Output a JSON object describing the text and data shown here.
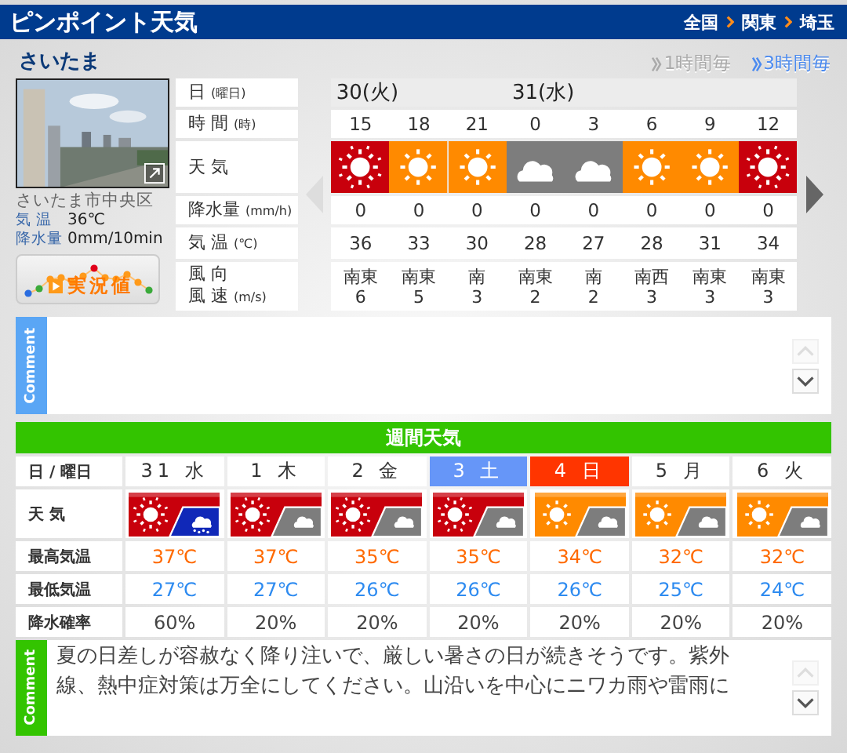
{
  "header": {
    "title": "ピンポイント天気",
    "breadcrumb": [
      "全国",
      "関東",
      "埼玉"
    ]
  },
  "location": "さいたま",
  "intervals": [
    {
      "label": "1時間毎",
      "selected": false
    },
    {
      "label": "3時間毎",
      "selected": true
    }
  ],
  "observation": {
    "place": "さいたま市中央区",
    "readings": [
      {
        "label": "気 温",
        "value": "36℃"
      },
      {
        "label": "降水量",
        "value": "0mm/10min"
      }
    ],
    "button": "実況値"
  },
  "hourly": {
    "prev_disabled": true,
    "next_disabled": false,
    "row_labels": [
      {
        "text": "日",
        "unit": "(曜日)"
      },
      {
        "text": "時 間",
        "unit": "(時)"
      },
      {
        "text": "天 気"
      },
      {
        "text": "降水量",
        "unit": "(mm/h)"
      },
      {
        "text": "気 温",
        "unit": "(℃)"
      },
      {
        "text": "風 向",
        "text2": "風 速",
        "unit": "(m/s)"
      }
    ],
    "dates": [
      {
        "label": "30(火)",
        "hours": [
          {
            "time": "15",
            "kind": "hot",
            "precip": "0",
            "temp": "36",
            "wind_dir": "南東",
            "wind_speed": "6"
          },
          {
            "time": "18",
            "kind": "sunny",
            "precip": "0",
            "temp": "33",
            "wind_dir": "南東",
            "wind_speed": "5"
          },
          {
            "time": "21",
            "kind": "sunny",
            "precip": "0",
            "temp": "30",
            "wind_dir": "南",
            "wind_speed": "3"
          }
        ]
      },
      {
        "label": "31(水)",
        "hours": [
          {
            "time": "0",
            "kind": "cloudy",
            "precip": "0",
            "temp": "28",
            "wind_dir": "南東",
            "wind_speed": "2"
          },
          {
            "time": "3",
            "kind": "cloudy",
            "precip": "0",
            "temp": "27",
            "wind_dir": "南",
            "wind_speed": "2"
          },
          {
            "time": "6",
            "kind": "sunny",
            "precip": "0",
            "temp": "28",
            "wind_dir": "南西",
            "wind_speed": "3"
          },
          {
            "time": "9",
            "kind": "sunny",
            "precip": "0",
            "temp": "31",
            "wind_dir": "南東",
            "wind_speed": "3"
          },
          {
            "time": "12",
            "kind": "hot",
            "precip": "0",
            "temp": "34",
            "wind_dir": "南東",
            "wind_speed": "3"
          }
        ]
      }
    ]
  },
  "comment_top": {
    "tab": "Comment",
    "up_disabled": true,
    "down_disabled": false
  },
  "weekly": {
    "title": "週間天気",
    "row_labels": [
      "日 / 曜日",
      "天 気",
      "最高気温",
      "最低気温",
      "降水確率"
    ],
    "days": [
      {
        "label": "31 水",
        "kind": "weekday",
        "weather": [
          {
            "kind": "hot"
          },
          {
            "kind": "rain"
          }
        ],
        "high": "37℃",
        "low": "27℃",
        "precip": "60%"
      },
      {
        "label": "1 木",
        "kind": "weekday",
        "weather": [
          {
            "kind": "hot"
          },
          {
            "kind": "cloudy"
          }
        ],
        "high": "37℃",
        "low": "27℃",
        "precip": "20%"
      },
      {
        "label": "2 金",
        "kind": "weekday",
        "weather": [
          {
            "kind": "hot"
          },
          {
            "kind": "cloudy"
          }
        ],
        "high": "35℃",
        "low": "26℃",
        "precip": "20%"
      },
      {
        "label": "3 土",
        "kind": "saturday",
        "weather": [
          {
            "kind": "hot"
          },
          {
            "kind": "cloudy"
          }
        ],
        "high": "35℃",
        "low": "26℃",
        "precip": "20%"
      },
      {
        "label": "4 日",
        "kind": "sunday",
        "weather": [
          {
            "kind": "sunny"
          },
          {
            "kind": "cloudy"
          }
        ],
        "high": "34℃",
        "low": "26℃",
        "precip": "20%"
      },
      {
        "label": "5 月",
        "kind": "weekday",
        "weather": [
          {
            "kind": "sunny"
          },
          {
            "kind": "cloudy"
          }
        ],
        "high": "32℃",
        "low": "25℃",
        "precip": "20%"
      },
      {
        "label": "6 火",
        "kind": "weekday",
        "weather": [
          {
            "kind": "sunny"
          },
          {
            "kind": "cloudy"
          }
        ],
        "high": "32℃",
        "low": "24℃",
        "precip": "20%"
      }
    ]
  },
  "comment_bottom": {
    "tab": "Comment",
    "text": "夏の日差しが容赦なく降り注いで、厳しい暑さの日が続きそうです。紫外線、熱中症対策は万全にしてください。山沿いを中心にニワカ雨や雷雨に",
    "up_disabled": true,
    "down_disabled": false
  }
}
